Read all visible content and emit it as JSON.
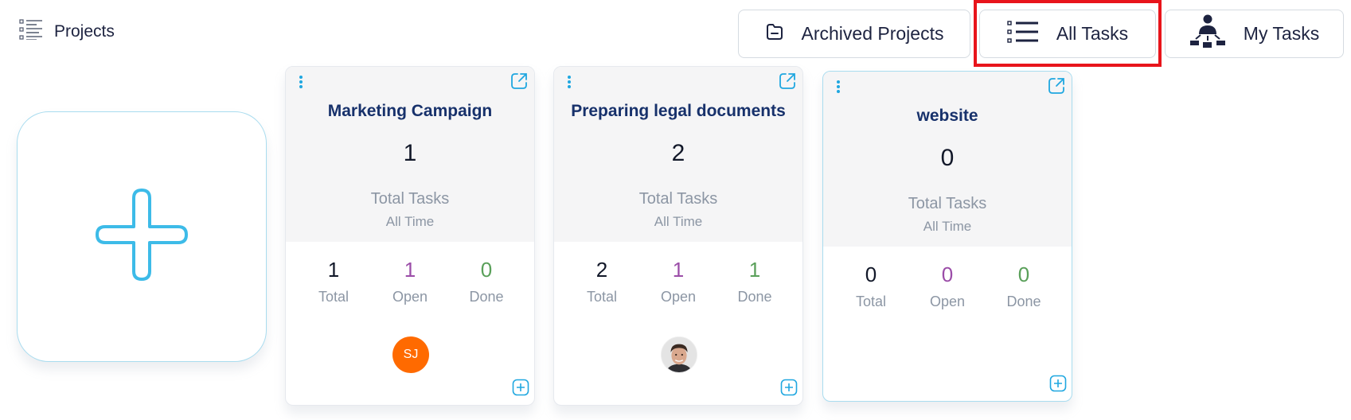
{
  "header": {
    "title": "Projects",
    "icon": "list-icon"
  },
  "toolbar": {
    "archived_label": "Archived Projects",
    "archived_icon": "folder-minus-icon",
    "all_tasks_label": "All Tasks",
    "all_tasks_icon": "task-list-icon",
    "my_tasks_label": "My Tasks",
    "my_tasks_icon": "user-hierarchy-icon",
    "highlighted": "All Tasks",
    "highlight_color": "#e8141b"
  },
  "add_project": {
    "icon": "plus-icon",
    "color": "#3dbbe8"
  },
  "projects": [
    {
      "title": "Marketing Campaign",
      "total_tasks": "1",
      "total_tasks_label": "Total Tasks",
      "period_label": "All Time",
      "stats": {
        "total": "1",
        "total_label": "Total",
        "open": "1",
        "open_label": "Open",
        "done": "0",
        "done_label": "Done"
      },
      "member": {
        "type": "initials",
        "initials": "SJ",
        "color": "#ff6a00"
      }
    },
    {
      "title": "Preparing legal documents",
      "total_tasks": "2",
      "total_tasks_label": "Total Tasks",
      "period_label": "All Time",
      "stats": {
        "total": "2",
        "total_label": "Total",
        "open": "1",
        "open_label": "Open",
        "done": "1",
        "done_label": "Done"
      },
      "member": {
        "type": "photo"
      }
    },
    {
      "title": "website",
      "total_tasks": "0",
      "total_tasks_label": "Total Tasks",
      "period_label": "All Time",
      "stats": {
        "total": "0",
        "total_label": "Total",
        "open": "0",
        "open_label": "Open",
        "done": "0",
        "done_label": "Done"
      },
      "member": null
    }
  ],
  "colors": {
    "accent": "#1fa7e0",
    "title": "#17316b",
    "open": "#9b4da8",
    "done": "#5aa05a",
    "muted": "#8c96a4"
  }
}
